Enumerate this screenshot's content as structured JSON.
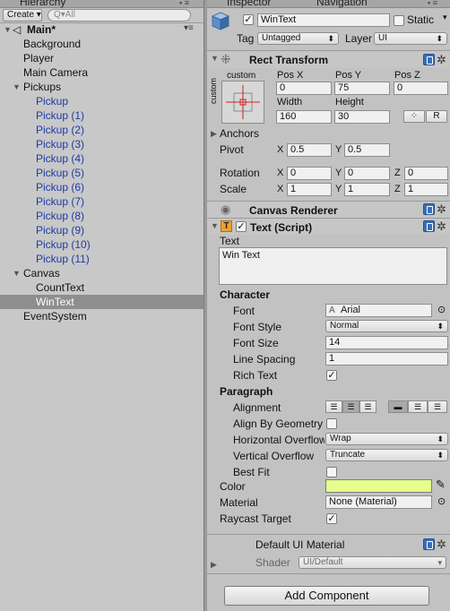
{
  "hierarchy": {
    "tab_title": "Hierarchy",
    "create_label": "Create ▾",
    "search_placeholder": "Q▾All",
    "items": [
      {
        "label": "Main*"
      },
      {
        "label": "Background"
      },
      {
        "label": "Player"
      },
      {
        "label": "Main Camera"
      },
      {
        "label": "Pickups"
      },
      {
        "label": "Pickup"
      },
      {
        "label": "Pickup (1)"
      },
      {
        "label": "Pickup (2)"
      },
      {
        "label": "Pickup (3)"
      },
      {
        "label": "Pickup (4)"
      },
      {
        "label": "Pickup (5)"
      },
      {
        "label": "Pickup (6)"
      },
      {
        "label": "Pickup (7)"
      },
      {
        "label": "Pickup (8)"
      },
      {
        "label": "Pickup (9)"
      },
      {
        "label": "Pickup (10)"
      },
      {
        "label": "Pickup (11)"
      },
      {
        "label": "Canvas"
      },
      {
        "label": "CountText"
      },
      {
        "label": "WinText"
      },
      {
        "label": "EventSystem"
      }
    ]
  },
  "inspector": {
    "tab_inspector": "Inspector",
    "tab_navigation": "Navigation",
    "object_name": "WinText",
    "static_label": "Static",
    "tag_label": "Tag",
    "tag_value": "Untagged",
    "layer_label": "Layer",
    "layer_value": "UI",
    "rect_transform": {
      "title": "Rect Transform",
      "anchor_preset": "custom",
      "anchor_side": "custom",
      "posx_label": "Pos X",
      "posy_label": "Pos Y",
      "posz_label": "Pos Z",
      "posx": "0",
      "posy": "75",
      "posz": "0",
      "width_label": "Width",
      "height_label": "Height",
      "width": "160",
      "height": "30",
      "r_button": "R",
      "anchors_label": "Anchors",
      "pivot_label": "Pivot",
      "pivot_x": "0.5",
      "pivot_y": "0.5",
      "rotation_label": "Rotation",
      "rot_x": "0",
      "rot_y": "0",
      "rot_z": "0",
      "scale_label": "Scale",
      "scale_x": "1",
      "scale_y": "1",
      "scale_z": "1",
      "x": "X",
      "y": "Y",
      "z": "Z"
    },
    "canvas_renderer": {
      "title": "Canvas Renderer"
    },
    "text_script": {
      "title": "Text (Script)",
      "text_label": "Text",
      "text_value": "Win Text",
      "character_label": "Character",
      "font_label": "Font",
      "font_value": "Arial",
      "font_style_label": "Font Style",
      "font_style_value": "Normal",
      "font_size_label": "Font Size",
      "font_size_value": "14",
      "line_spacing_label": "Line Spacing",
      "line_spacing_value": "1",
      "rich_text_label": "Rich Text",
      "paragraph_label": "Paragraph",
      "alignment_label": "Alignment",
      "align_geometry_label": "Align By Geometry",
      "h_overflow_label": "Horizontal Overflow",
      "h_overflow_value": "Wrap",
      "v_overflow_label": "Vertical Overflow",
      "v_overflow_value": "Truncate",
      "best_fit_label": "Best Fit",
      "color_label": "Color",
      "color_value": "#e6ff8c",
      "material_label": "Material",
      "material_value": "None (Material)",
      "raycast_label": "Raycast Target"
    },
    "default_material": {
      "title": "Default UI Material",
      "shader_label": "Shader",
      "shader_value": "UI/Default"
    },
    "add_component_label": "Add Component"
  }
}
